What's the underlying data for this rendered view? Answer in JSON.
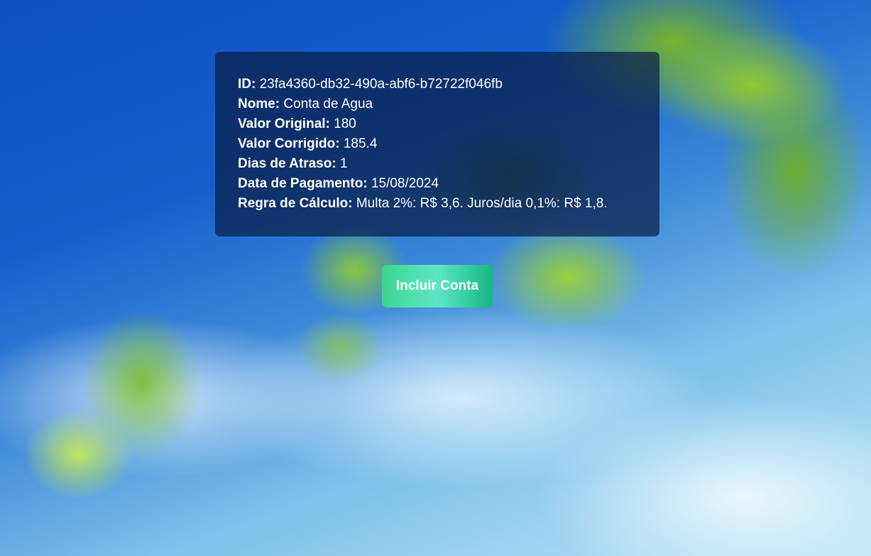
{
  "details": {
    "id_label": "ID:",
    "id_value": "23fa4360-db32-490a-abf6-b72722f046fb",
    "nome_label": "Nome:",
    "nome_value": "Conta de Agua",
    "valor_original_label": "Valor Original:",
    "valor_original_value": "180",
    "valor_corrigido_label": "Valor Corrigido:",
    "valor_corrigido_value": "185.4",
    "dias_atraso_label": "Dias de Atraso:",
    "dias_atraso_value": "1",
    "data_pagamento_label": "Data de Pagamento:",
    "data_pagamento_value": "15/08/2024",
    "regra_calculo_label": "Regra de Cálculo:",
    "regra_calculo_value": "Multa 2%: R$ 3,6. Juros/dia 0,1%: R$ 1,8."
  },
  "actions": {
    "incluir_label": "Incluir Conta"
  },
  "colors": {
    "card_background": "#0a1e46",
    "button_gradient_start": "#3dd68c",
    "button_gradient_end": "#14b87f"
  }
}
